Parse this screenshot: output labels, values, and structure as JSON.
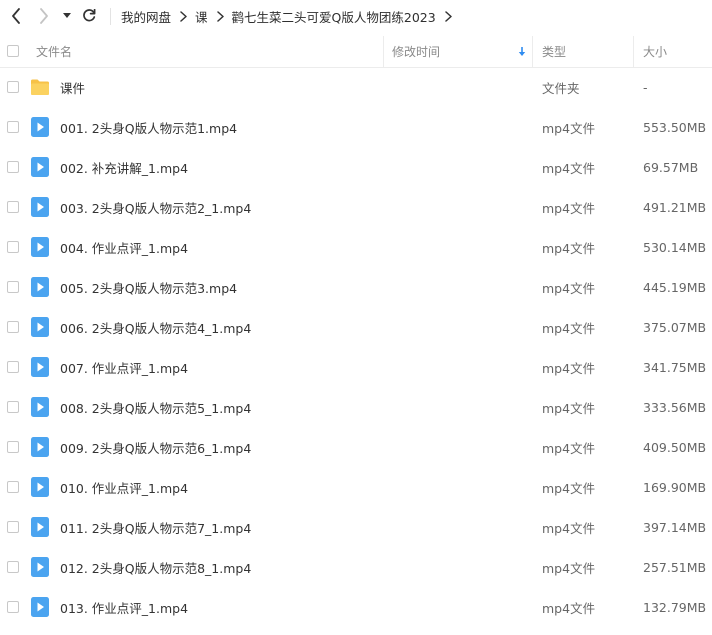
{
  "toolbar": {
    "breadcrumb": [
      "我的网盘",
      "课",
      "鹳七生菜二头可爱Q版人物团练2023"
    ]
  },
  "header": {
    "name": "文件名",
    "modified": "修改时间",
    "type": "类型",
    "size": "大小",
    "sort_indicator": "sort-desc-arrow"
  },
  "colors": {
    "accent": "#2f8cf0",
    "folder": "#f7c248",
    "video": "#4ba4f0"
  },
  "files": [
    {
      "icon": "folder-icon",
      "name": "课件",
      "type": "文件夹",
      "size": "-"
    },
    {
      "icon": "video-file-icon",
      "name": "001. 2头身Q版人物示范1.mp4",
      "type": "mp4文件",
      "size": "553.50MB"
    },
    {
      "icon": "video-file-icon",
      "name": "002. 补充讲解_1.mp4",
      "type": "mp4文件",
      "size": "69.57MB"
    },
    {
      "icon": "video-file-icon",
      "name": "003. 2头身Q版人物示范2_1.mp4",
      "type": "mp4文件",
      "size": "491.21MB"
    },
    {
      "icon": "video-file-icon",
      "name": "004. 作业点评_1.mp4",
      "type": "mp4文件",
      "size": "530.14MB"
    },
    {
      "icon": "video-file-icon",
      "name": "005. 2头身Q版人物示范3.mp4",
      "type": "mp4文件",
      "size": "445.19MB"
    },
    {
      "icon": "video-file-icon",
      "name": "006. 2头身Q版人物示范4_1.mp4",
      "type": "mp4文件",
      "size": "375.07MB"
    },
    {
      "icon": "video-file-icon",
      "name": "007. 作业点评_1.mp4",
      "type": "mp4文件",
      "size": "341.75MB"
    },
    {
      "icon": "video-file-icon",
      "name": "008. 2头身Q版人物示范5_1.mp4",
      "type": "mp4文件",
      "size": "333.56MB"
    },
    {
      "icon": "video-file-icon",
      "name": "009. 2头身Q版人物示范6_1.mp4",
      "type": "mp4文件",
      "size": "409.50MB"
    },
    {
      "icon": "video-file-icon",
      "name": "010. 作业点评_1.mp4",
      "type": "mp4文件",
      "size": "169.90MB"
    },
    {
      "icon": "video-file-icon",
      "name": "011. 2头身Q版人物示范7_1.mp4",
      "type": "mp4文件",
      "size": "397.14MB"
    },
    {
      "icon": "video-file-icon",
      "name": "012. 2头身Q版人物示范8_1.mp4",
      "type": "mp4文件",
      "size": "257.51MB"
    },
    {
      "icon": "video-file-icon",
      "name": "013. 作业点评_1.mp4",
      "type": "mp4文件",
      "size": "132.79MB"
    }
  ]
}
